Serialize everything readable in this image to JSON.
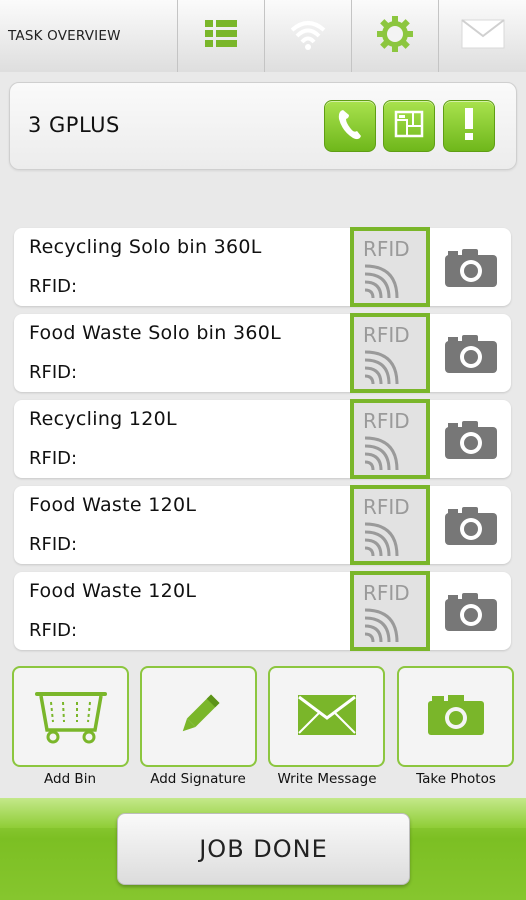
{
  "topbar": {
    "title": "TASK OVERVIEW",
    "tabs": [
      {
        "icon": "list-icon"
      },
      {
        "icon": "wifi-icon"
      },
      {
        "icon": "gear-icon"
      },
      {
        "icon": "mail-icon"
      }
    ]
  },
  "header": {
    "job_title": "3 GPLUS",
    "buttons": [
      {
        "icon": "phone-icon"
      },
      {
        "icon": "map-icon"
      },
      {
        "icon": "alert-icon"
      }
    ]
  },
  "bins": [
    {
      "name": "Recycling Solo bin 360L",
      "rfid_label": "RFID:",
      "rfid_badge": "RFID"
    },
    {
      "name": "Food Waste Solo bin 360L",
      "rfid_label": "RFID:",
      "rfid_badge": "RFID"
    },
    {
      "name": "Recycling 120L",
      "rfid_label": "RFID:",
      "rfid_badge": "RFID"
    },
    {
      "name": "Food Waste 120L",
      "rfid_label": "RFID:",
      "rfid_badge": "RFID"
    },
    {
      "name": "Food Waste 120L",
      "rfid_label": "RFID:",
      "rfid_badge": "RFID"
    }
  ],
  "actions": [
    {
      "label": "Add Bin",
      "icon": "bin-icon"
    },
    {
      "label": "Add Signature",
      "icon": "pencil-icon"
    },
    {
      "label": "Write Message",
      "icon": "envelope-icon"
    },
    {
      "label": "Take Photos",
      "icon": "camera-icon"
    }
  ],
  "footer": {
    "job_done_label": "JOB DONE"
  },
  "colors": {
    "accent": "#7ab62a",
    "accent_light": "#a9e24e",
    "background": "#e9e9e9"
  }
}
